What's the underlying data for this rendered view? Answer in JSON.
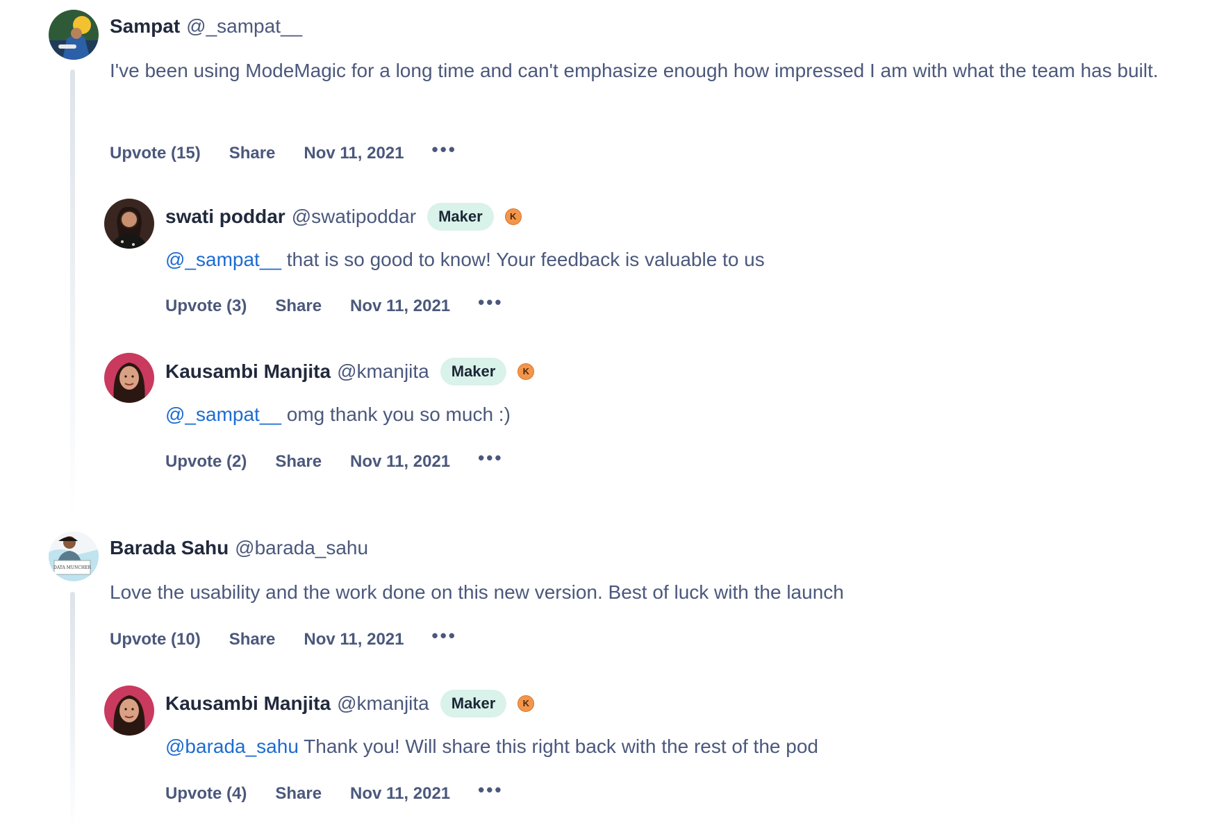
{
  "comments": [
    {
      "name": "Sampat",
      "handle": "@_sampat__",
      "text": "I've been using ModeMagic for a long time and can't emphasize enough how impressed I am with what the team has built.",
      "upvote": "Upvote (15)",
      "share": "Share",
      "date": "Nov 11, 2021",
      "more": "•••",
      "replies": [
        {
          "name": "swati poddar",
          "handle": "@swatipoddar",
          "badge": "Maker",
          "karma": "K",
          "mention": "@_sampat__",
          "text": " that is so good to know! Your feedback is valuable to us",
          "upvote": "Upvote (3)",
          "share": "Share",
          "date": "Nov 11, 2021",
          "more": "•••"
        },
        {
          "name": "Kausambi Manjita",
          "handle": "@kmanjita",
          "badge": "Maker",
          "karma": "K",
          "mention": "@_sampat__",
          "text": " omg thank you so much :)",
          "upvote": "Upvote (2)",
          "share": "Share",
          "date": "Nov 11, 2021",
          "more": "•••"
        }
      ]
    },
    {
      "name": "Barada Sahu",
      "handle": "@barada_sahu",
      "text": "Love the usability and the work done on this new version. Best of luck with the launch",
      "upvote": "Upvote (10)",
      "share": "Share",
      "date": "Nov 11, 2021",
      "more": "•••",
      "replies": [
        {
          "name": "Kausambi Manjita",
          "handle": "@kmanjita",
          "badge": "Maker",
          "karma": "K",
          "mention": "@barada_sahu",
          "text": " Thank you! Will share this right back with the rest of the pod",
          "upvote": "Upvote (4)",
          "share": "Share",
          "date": "Nov 11, 2021",
          "more": "•••"
        }
      ]
    }
  ],
  "avatar_sign_text": "DATA MUNCHER",
  "colors": {
    "text_primary": "#21293c",
    "text_secondary": "#4b587c",
    "mention": "#1c6bd1",
    "maker_badge_bg": "#d9f2ea",
    "karma_badge": "#f3964b",
    "thread_line": "#dde3ea"
  }
}
